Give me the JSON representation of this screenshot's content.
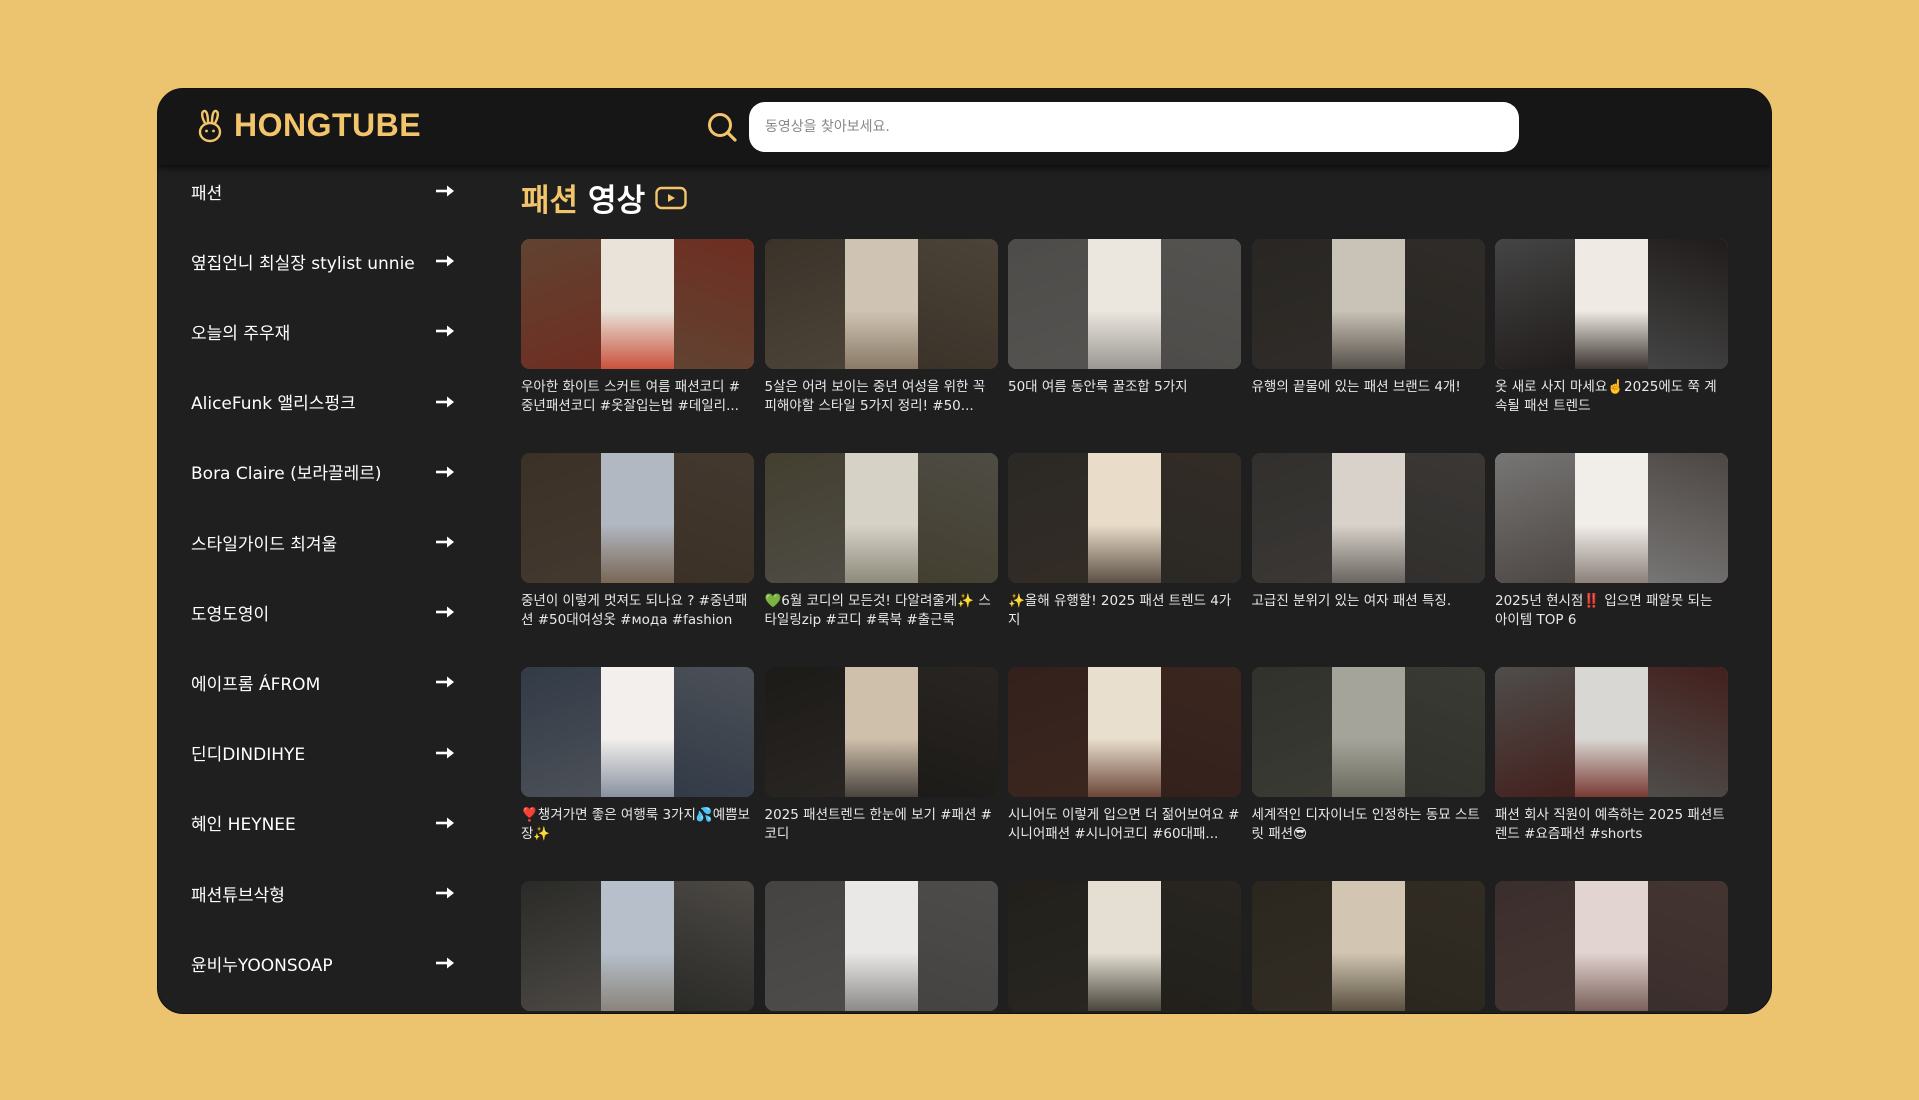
{
  "app": {
    "logo_text": "HONGTUBE",
    "logo_icon": "rabbit-icon",
    "accent_color": "#f3c56b",
    "background_color": "#ecc46f"
  },
  "search": {
    "placeholder": "동영상을 찾아보세요.",
    "value": ""
  },
  "sidebar": {
    "items": [
      {
        "label": "패션"
      },
      {
        "label": "옆집언니 최실장 stylist unnie"
      },
      {
        "label": "오늘의 주우재"
      },
      {
        "label": "AliceFunk 앨리스펑크"
      },
      {
        "label": "Bora Claire (보라끌레르)"
      },
      {
        "label": "스타일가이드 최겨울"
      },
      {
        "label": "도영도영이"
      },
      {
        "label": "에이프롬 ÁFROM"
      },
      {
        "label": "딘디DINDIHYE"
      },
      {
        "label": "혜인 HEYNEE"
      },
      {
        "label": "패션튜브삭형"
      },
      {
        "label": "윤비누YOONSOAP"
      }
    ]
  },
  "main": {
    "title_accent": "패션",
    "title_rest": "영상",
    "videos": [
      {
        "title": "우아한 화이트 스커트 여름 패션코디 # 중년패션코디 #옷잘입는법 #데일리...",
        "colors": [
          "#b07a5a",
          "#e9e3da",
          "#c9523c"
        ]
      },
      {
        "title": "5살은 어려 보이는 중년 여성을 위한 꼭 피해야할 스타일 5가지 정리! #50...",
        "colors": [
          "#6b5b4a",
          "#cfc4b4",
          "#8a7a66"
        ]
      },
      {
        "title": "50대 여름 동안룩 꿀조합 5가지",
        "colors": [
          "#8c8a86",
          "#ebe7df",
          "#9a9792"
        ]
      },
      {
        "title": "유행의 끝물에 있는 패션 브랜드 4개!",
        "colors": [
          "#4a4540",
          "#c9c2b6",
          "#55504a"
        ]
      },
      {
        "title": "옷 새로 사지 마세요☝️2025에도 쭉 계속될 패션 트렌드",
        "colors": [
          "#7d7d7d",
          "#efeae3",
          "#3a3330"
        ]
      },
      {
        "title": "중년이 이렇게 멋져도 되나요 ? #중년패션 #50대여성옷 #мода #fashion",
        "colors": [
          "#6a5846",
          "#b1b8c2",
          "#7a6755"
        ]
      },
      {
        "title": "💚6월 코디의 모든것! 다알려줄게✨ 스타일링zip #코디 #룩북 #출근룩",
        "colors": [
          "#7a7256",
          "#d6d2c6",
          "#8e8a7c"
        ]
      },
      {
        "title": "✨올해 유행할! 2025 패션 트렌드 4가지",
        "colors": [
          "#4e4a44",
          "#e9dcc8",
          "#5c5046"
        ]
      },
      {
        "title": "고급진 분위기 있는 여자 패션 특징.",
        "colors": [
          "#5a5652",
          "#d8d2ca",
          "#6a6560"
        ]
      },
      {
        "title": "2025년 현시점‼️ 입으면 패알못 되는 아이템 TOP 6",
        "colors": [
          "#d8d6d4",
          "#f1eeea",
          "#8b807a"
        ]
      },
      {
        "title": "❣️챙겨가면 좋은 여행룩 3가지💦예쁨보장✨",
        "colors": [
          "#5b6a80",
          "#f2efec",
          "#8a92a0"
        ]
      },
      {
        "title": "2025 패션트렌드 한눈에 보기 #패션 #코디",
        "colors": [
          "#34302c",
          "#cfc0ab",
          "#4a443e"
        ]
      },
      {
        "title": "시니어도 이렇게 입으면 더 젊어보여요 #시니어패션 #시니어코디 #60대패...",
        "colors": [
          "#5e3b33",
          "#e9dfce",
          "#6c4638"
        ]
      },
      {
        "title": "세계적인 디자이너도 인정하는 동묘 스트릿 패션😎",
        "colors": [
          "#5a5a50",
          "#a4a49a",
          "#6a6a5e"
        ]
      },
      {
        "title": "패션 회사 직원이 예측하는 2025 패션트렌드 #요즘패션 #shorts",
        "colors": [
          "#8e8c88",
          "#d9d7d3",
          "#7a3a34"
        ]
      },
      {
        "title": "",
        "colors": [
          "#4c4c48",
          "#b6bfca",
          "#8a847c"
        ]
      },
      {
        "title": "",
        "colors": [
          "#7c7a78",
          "#eae8e6",
          "#8c8a88"
        ]
      },
      {
        "title": "",
        "colors": [
          "#3e3a32",
          "#e4dfd2",
          "#4a453c"
        ]
      },
      {
        "title": "",
        "colors": [
          "#4e4638",
          "#d2c6b2",
          "#5a5040"
        ]
      },
      {
        "title": "",
        "colors": [
          "#6a5450",
          "#e2d4d0",
          "#7a605a"
        ]
      }
    ]
  }
}
